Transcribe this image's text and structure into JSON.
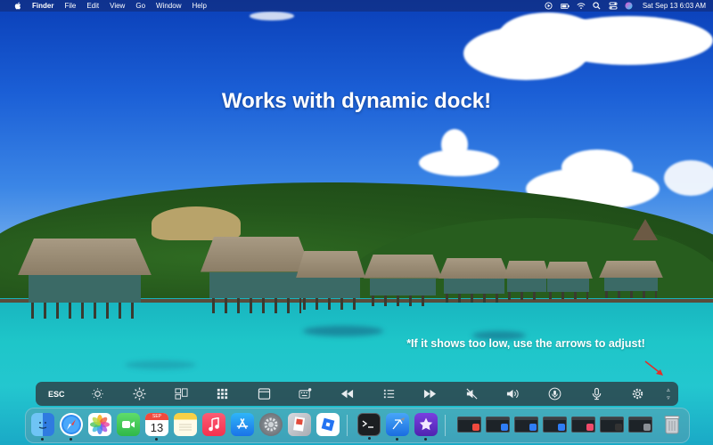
{
  "menubar": {
    "app_name": "Finder",
    "menus": [
      "File",
      "Edit",
      "View",
      "Go",
      "Window",
      "Help"
    ],
    "status_icons": [
      "play-circle-icon",
      "battery-icon",
      "wifi-icon",
      "search-icon",
      "control-center-icon",
      "siri-icon"
    ],
    "clock": "Sat Sep 13  6:03 AM"
  },
  "overlay": {
    "headline": "Works with dynamic dock!",
    "hint": "*If it shows too low, use the arrows to adjust!"
  },
  "strip": {
    "buttons": [
      {
        "name": "esc",
        "label": "ESC"
      },
      {
        "name": "brightness-down",
        "icon": "brightness-down-icon"
      },
      {
        "name": "brightness-up",
        "icon": "brightness-up-icon"
      },
      {
        "name": "mission-control",
        "icon": "mission-control-icon"
      },
      {
        "name": "launchpad",
        "icon": "launchpad-grid-icon"
      },
      {
        "name": "desktop",
        "icon": "window-icon"
      },
      {
        "name": "keyboard-brightness",
        "icon": "keyboard-icon"
      },
      {
        "name": "rewind",
        "icon": "rewind-icon"
      },
      {
        "name": "play-pause",
        "icon": "list-icon"
      },
      {
        "name": "fast-forward",
        "icon": "fast-forward-icon"
      },
      {
        "name": "mute",
        "icon": "mute-icon"
      },
      {
        "name": "volume",
        "icon": "volume-icon"
      },
      {
        "name": "voice-control",
        "icon": "microphone-circle-icon"
      },
      {
        "name": "dictation",
        "icon": "microphone-icon"
      },
      {
        "name": "settings",
        "icon": "gear-icon"
      }
    ],
    "adjust": {
      "up": "▵",
      "down": "▿"
    }
  },
  "dock": {
    "apps": [
      {
        "name": "finder",
        "icon": "finder-icon",
        "running": true
      },
      {
        "name": "safari",
        "icon": "safari-icon",
        "running": true
      },
      {
        "name": "photos",
        "icon": "photos-icon",
        "running": false
      },
      {
        "name": "facetime",
        "icon": "facetime-icon",
        "running": false
      },
      {
        "name": "calendar",
        "icon": "calendar-icon",
        "running": true,
        "month": "SEP",
        "day": "13"
      },
      {
        "name": "notes",
        "icon": "notes-icon",
        "running": false
      },
      {
        "name": "music",
        "icon": "music-icon",
        "running": false
      },
      {
        "name": "app-store",
        "icon": "app-store-icon",
        "running": false
      },
      {
        "name": "system-preferences",
        "icon": "gear-icon",
        "running": false
      },
      {
        "name": "preview",
        "icon": "preview-icon",
        "running": false
      },
      {
        "name": "roblox",
        "icon": "roblox-icon",
        "running": false
      },
      {
        "name": "terminal",
        "icon": "terminal-icon",
        "running": true
      },
      {
        "name": "xcode",
        "icon": "xcode-icon",
        "running": true
      },
      {
        "name": "imovie",
        "icon": "imovie-icon",
        "running": true
      }
    ],
    "minimized_windows": [
      {
        "name": "minimized-calendar",
        "badge_color": "#f04a3e"
      },
      {
        "name": "minimized-safari",
        "badge_color": "#2f7df6"
      },
      {
        "name": "minimized-xcode",
        "badge_color": "#2f7df6"
      },
      {
        "name": "minimized-app-store",
        "badge_color": "#2f7df6"
      },
      {
        "name": "minimized-music",
        "badge_color": "#f04a6a"
      },
      {
        "name": "minimized-terminal",
        "badge_color": "#333333"
      },
      {
        "name": "minimized-system-preferences",
        "badge_color": "#8a8f95"
      }
    ],
    "trash_icon": "trash-icon"
  }
}
